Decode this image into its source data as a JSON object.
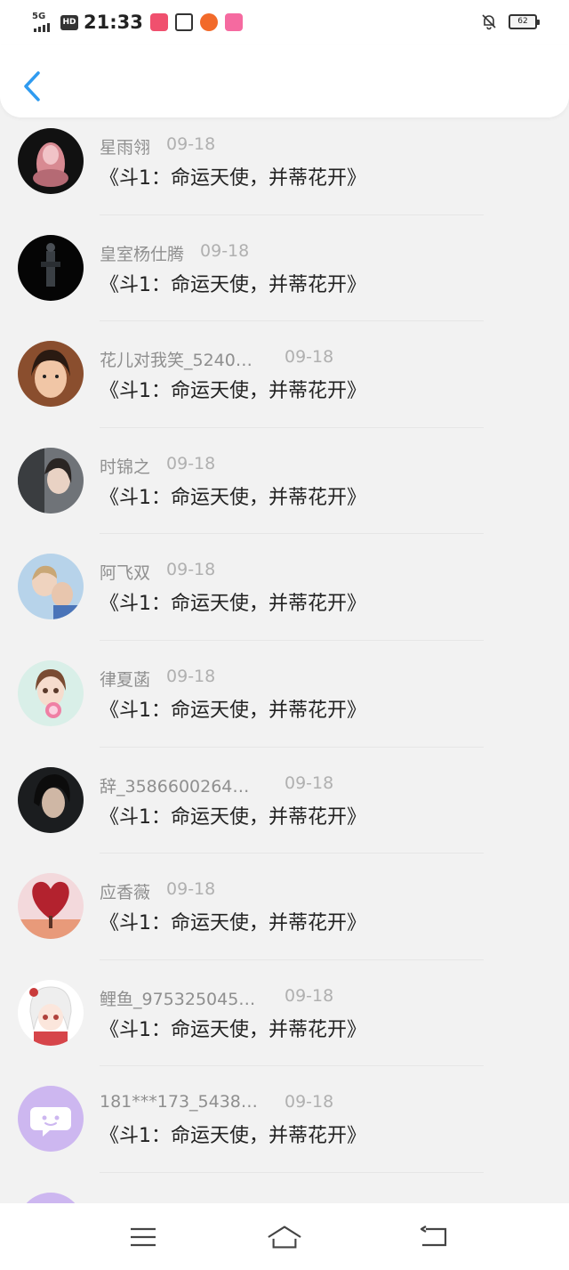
{
  "status_bar": {
    "network": "5G",
    "hd": "HD",
    "time": "21:33",
    "battery": "62"
  },
  "header": {
    "back_icon": "chevron-left-icon"
  },
  "list": [
    {
      "username": "星雨翎",
      "date": "09-18",
      "message": "《斗1：命运天使，并蒂花开》"
    },
    {
      "username": "皇室杨仕腾",
      "date": "09-18",
      "message": "《斗1：命运天使，并蒂花开》"
    },
    {
      "username": "花儿对我笑_5240…",
      "date": "09-18",
      "message": "《斗1：命运天使，并蒂花开》"
    },
    {
      "username": "时锦之",
      "date": "09-18",
      "message": "《斗1：命运天使，并蒂花开》"
    },
    {
      "username": "阿飞双",
      "date": "09-18",
      "message": "《斗1：命运天使，并蒂花开》"
    },
    {
      "username": "律夏菡",
      "date": "09-18",
      "message": "《斗1：命运天使，并蒂花开》"
    },
    {
      "username": "辞_3586600264…",
      "date": "09-18",
      "message": "《斗1：命运天使，并蒂花开》"
    },
    {
      "username": "应香薇",
      "date": "09-18",
      "message": "《斗1：命运天使，并蒂花开》"
    },
    {
      "username": "鲤鱼_975325045…",
      "date": "09-18",
      "message": "《斗1：命运天使，并蒂花开》"
    },
    {
      "username": "181***173_5438…",
      "date": "09-18",
      "message": "《斗1：命运天使，并蒂花开》"
    }
  ],
  "nav_bar": {
    "menu_icon": "menu-icon",
    "home_icon": "home-icon",
    "back_icon": "back-icon"
  },
  "colors": {
    "accent": "#2f9bf0",
    "text": "#222222",
    "meta": "#8f8f8f",
    "background": "#f2f2f2"
  }
}
